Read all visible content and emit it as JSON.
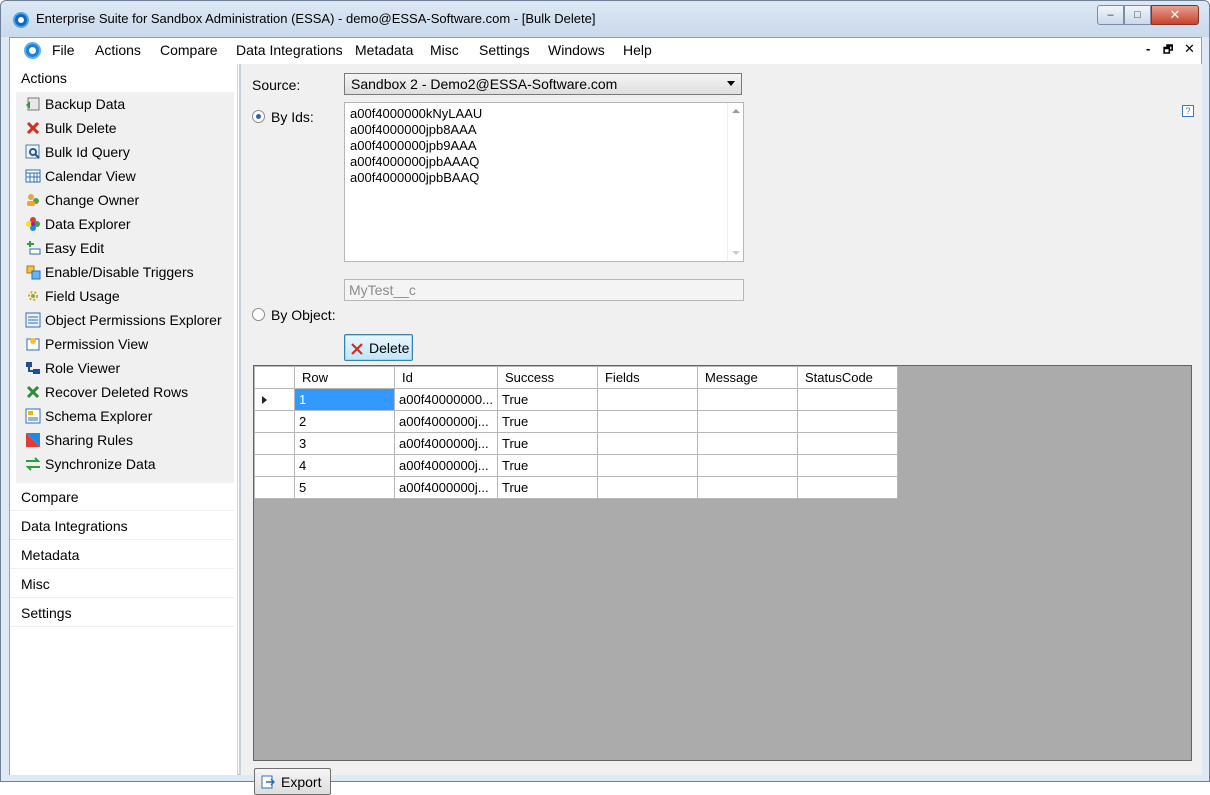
{
  "window": {
    "title": "Enterprise Suite for Sandbox Administration (ESSA) - demo@ESSA-Software.com - [Bulk Delete]",
    "controls": {
      "min": "–",
      "max": "□",
      "close": "✕"
    }
  },
  "menubar": {
    "items": [
      "File",
      "Actions",
      "Compare",
      "Data Integrations",
      "Metadata",
      "Misc",
      "Settings",
      "Windows",
      "Help"
    ],
    "mdi_controls": {
      "min": "-",
      "restore": "🗗",
      "close": "✕"
    }
  },
  "sidebar": {
    "actions_header": "Actions",
    "items": [
      {
        "label": "Backup Data",
        "icon": "backup-icon"
      },
      {
        "label": "Bulk Delete",
        "icon": "red-x-icon"
      },
      {
        "label": "Bulk Id Query",
        "icon": "query-icon"
      },
      {
        "label": "Calendar View",
        "icon": "calendar-icon"
      },
      {
        "label": "Change Owner",
        "icon": "users-icon"
      },
      {
        "label": "Data Explorer",
        "icon": "flower-icon"
      },
      {
        "label": "Easy Edit",
        "icon": "edit-icon"
      },
      {
        "label": "Enable/Disable Triggers",
        "icon": "trigger-icon"
      },
      {
        "label": "Field Usage",
        "icon": "field-usage-icon"
      },
      {
        "label": "Object Permissions Explorer",
        "icon": "permissions-list-icon"
      },
      {
        "label": "Permission View",
        "icon": "permission-view-icon"
      },
      {
        "label": "Role Viewer",
        "icon": "role-icon"
      },
      {
        "label": "Recover Deleted Rows",
        "icon": "green-x-icon"
      },
      {
        "label": "Schema Explorer",
        "icon": "schema-icon"
      },
      {
        "label": "Sharing Rules",
        "icon": "sharing-icon"
      },
      {
        "label": "Synchronize Data",
        "icon": "sync-icon"
      }
    ],
    "groups": [
      "Compare",
      "Data Integrations",
      "Metadata",
      "Misc",
      "Settings"
    ]
  },
  "form": {
    "source_label": "Source:",
    "source_value": "Sandbox 2 - Demo2@ESSA-Software.com",
    "by_ids_label": "By Ids:",
    "ids": [
      "a00f4000000kNyLAAU",
      "a00f4000000jpb8AAA",
      "a00f4000000jpb9AAA",
      "a00f4000000jpbAAAQ",
      "a00f4000000jpbBAAQ"
    ],
    "by_object_label": "By Object:",
    "object_placeholder": "MyTest__c",
    "delete_label": "Delete",
    "export_label": "Export",
    "help_glyph": "?"
  },
  "grid": {
    "columns": [
      "Row",
      "Id",
      "Success",
      "Fields",
      "Message",
      "StatusCode"
    ],
    "rows": [
      {
        "row": "1",
        "id": "a00f40000000...",
        "success": "True",
        "fields": "",
        "message": "",
        "status": ""
      },
      {
        "row": "2",
        "id": "a00f4000000j...",
        "success": "True",
        "fields": "",
        "message": "",
        "status": ""
      },
      {
        "row": "3",
        "id": "a00f4000000j...",
        "success": "True",
        "fields": "",
        "message": "",
        "status": ""
      },
      {
        "row": "4",
        "id": "a00f4000000j...",
        "success": "True",
        "fields": "",
        "message": "",
        "status": ""
      },
      {
        "row": "5",
        "id": "a00f4000000j...",
        "success": "True",
        "fields": "",
        "message": "",
        "status": ""
      }
    ]
  }
}
